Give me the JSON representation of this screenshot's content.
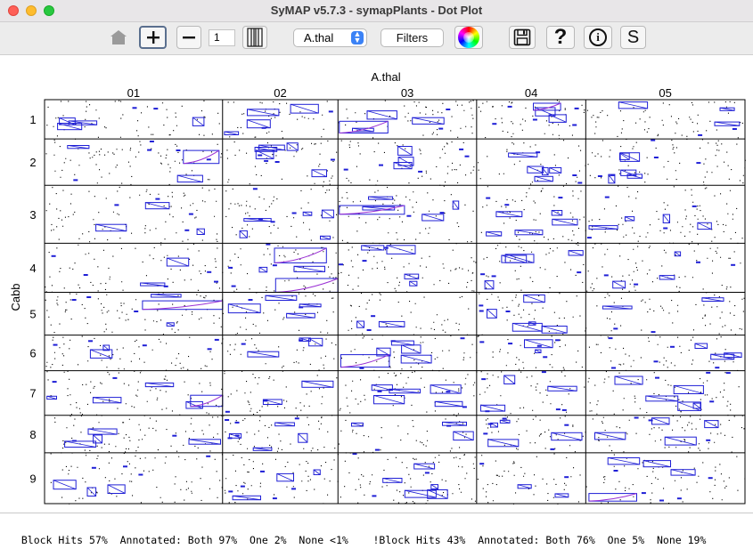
{
  "window": {
    "title": "SyMAP v5.7.3 - symapPlants - Dot Plot"
  },
  "toolbar": {
    "home_icon": "house-icon",
    "zoom_in_icon": "plus-icon",
    "zoom_out_icon": "minus-icon",
    "zoom_value": "1",
    "fit_icon": "fit-columns-icon",
    "reference_select": "A.thal",
    "filters_label": "Filters",
    "color_icon": "color-wheel-icon",
    "save_icon": "floppy-disk-icon",
    "help_label": "?",
    "info_label": "i",
    "stats_label": "S"
  },
  "plot": {
    "x_genome": "A.thal",
    "y_genome": "Cabb",
    "x_chromosomes": [
      "01",
      "02",
      "03",
      "04",
      "05"
    ],
    "y_chromosomes": [
      "1",
      "2",
      "3",
      "4",
      "5",
      "6",
      "7",
      "8",
      "9"
    ],
    "x_relative_lengths": [
      199,
      129,
      155,
      122,
      178
    ],
    "y_relative_lengths": [
      44,
      52,
      65,
      55,
      48,
      40,
      50,
      42,
      57
    ],
    "dot_color": "#000000",
    "block_color": "#1f1fd6"
  },
  "status": {
    "text": "Block Hits 57%  Annotated: Both 97%  One 2%  None <1%    !Block Hits 43%  Annotated: Both 76%  One 5%  None 19%"
  }
}
